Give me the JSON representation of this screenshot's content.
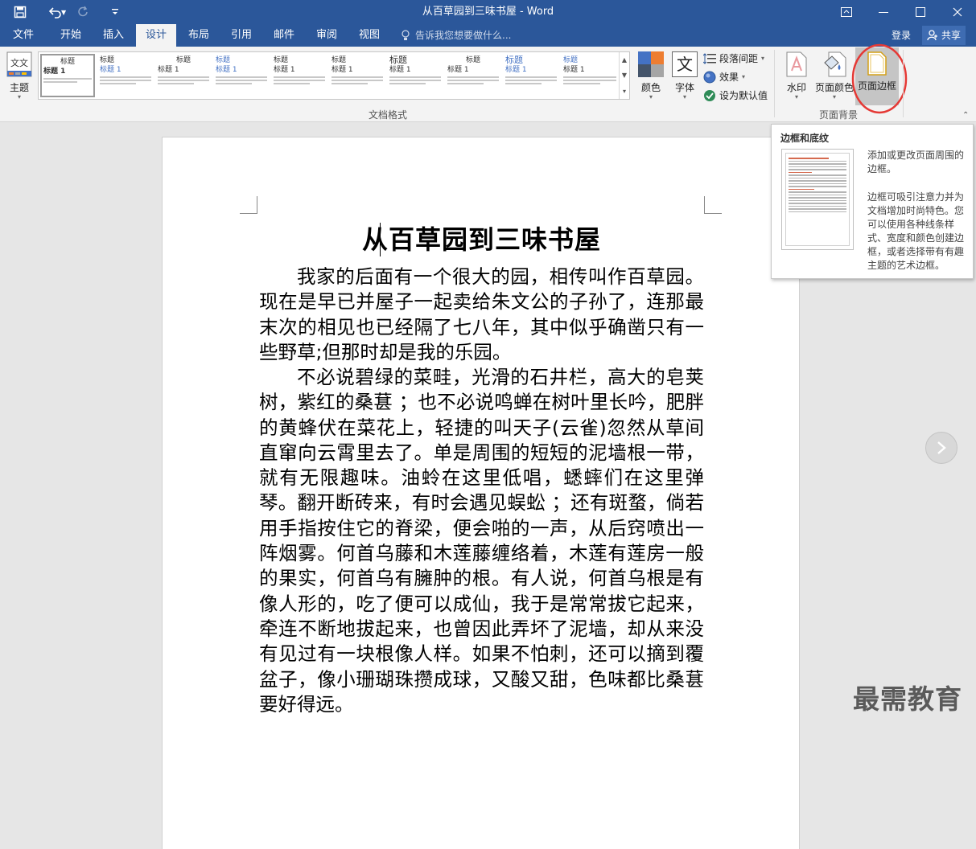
{
  "window": {
    "title": "从百草园到三味书屋 - Word"
  },
  "tabs": [
    "文件",
    "开始",
    "插入",
    "设计",
    "布局",
    "引用",
    "邮件",
    "审阅",
    "视图"
  ],
  "active_tab": "设计",
  "tellme": {
    "placeholder": "告诉我您想要做什么..."
  },
  "account": {
    "login": "登录",
    "share": "共享"
  },
  "ribbon": {
    "theme_label": "主题",
    "gallery_titles": [
      "标题",
      "标题",
      "标题",
      "标题",
      "标题",
      "标题",
      "标题",
      "标题",
      "标题",
      "标题"
    ],
    "gallery_subtitle": "标题 1",
    "colors_label": "颜色",
    "fonts_label": "字体",
    "paragraph_spacing": "段落间距",
    "effects": "效果",
    "set_default": "设为默认值",
    "doc_format_group": "文档格式",
    "watermark_label": "水印",
    "page_color_label": "页面颜色",
    "page_borders_label": "页面边框",
    "page_background_group": "页面背景"
  },
  "tooltip": {
    "title": "边框和底纹",
    "line1": "添加或更改页面周围的边框。",
    "line2": "边框可吸引注意力并为文档增加时尚特色。您可以使用各种线条样式、宽度和颜色创建边框，或者选择带有有趣主题的艺术边框。"
  },
  "document": {
    "heading": "从百草园到三味书屋",
    "paragraphs": [
      "我家的后面有一个很大的园，相传叫作百草园。现在是早已并屋子一起卖给朱文公的子孙了，连那最末次的相见也已经隔了七八年，其中似乎确凿只有一些野草;但那时却是我的乐园。",
      "不必说碧绿的菜畦，光滑的石井栏，高大的皂荚树，紫红的桑葚 ；也不必说鸣蝉在树叶里长吟，肥胖的黄蜂伏在菜花上，轻捷的叫天子(云雀)忽然从草间直窜向云霄里去了。单是周围的短短的泥墙根一带，就有无限趣味。油蛉在这里低唱，蟋蟀们在这里弹琴。翻开断砖来，有时会遇见蜈蚣 ；还有斑蝥，倘若用手指按住它的脊梁，便会啪的一声，从后窍喷出一阵烟雾。何首乌藤和木莲藤缠络着，木莲有莲房一般的果实，何首乌有臃肿的根。有人说，何首乌根是有像人形的，吃了便可以成仙，我于是常常拔它起来，牵连不断地拔起来，也曾因此弄坏了泥墙，却从来没有见过有一块根像人样。如果不怕刺，还可以摘到覆盆子，像小珊瑚珠攒成球，又酸又甜，色味都比桑葚要好得远。"
    ]
  },
  "watermark_text": "最需教育",
  "colors": {
    "title_bar": "#2b579a",
    "ribbon": "#f3f3f3",
    "highlight_circle": "#e53935"
  }
}
